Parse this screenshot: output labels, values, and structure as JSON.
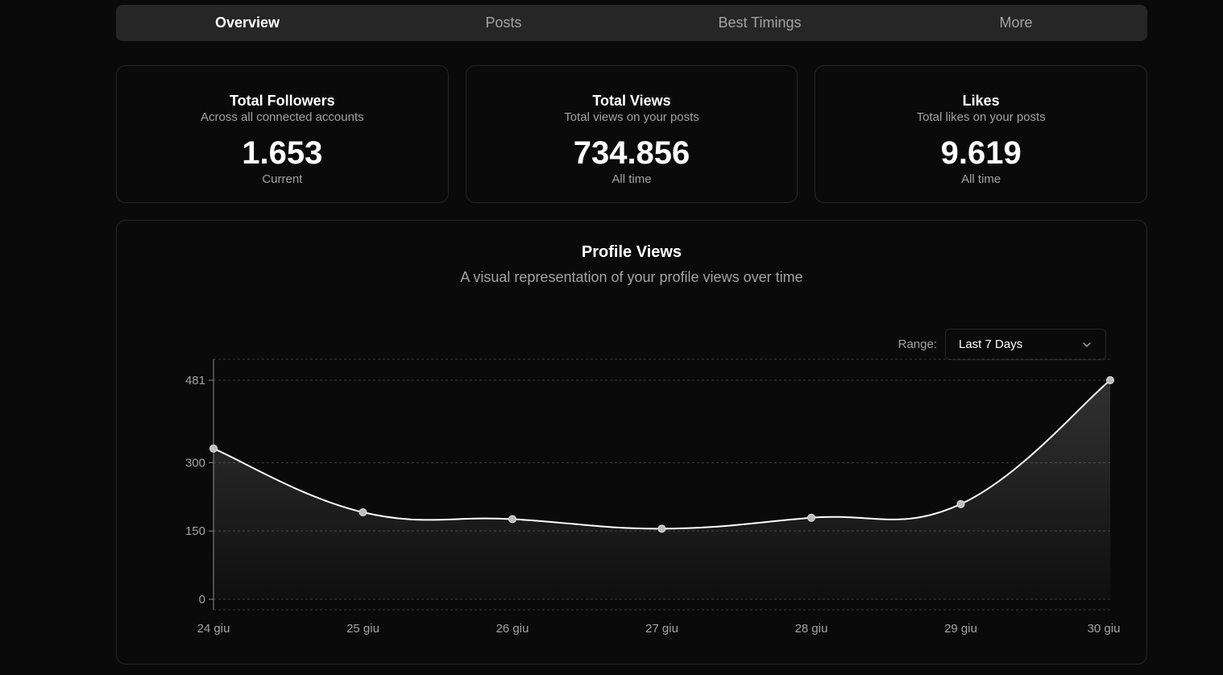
{
  "tabs": [
    {
      "label": "Overview",
      "active": true
    },
    {
      "label": "Posts",
      "active": false
    },
    {
      "label": "Best Timings",
      "active": false
    },
    {
      "label": "More",
      "active": false
    }
  ],
  "cards": [
    {
      "title": "Total Followers",
      "subtitle": "Across all connected accounts",
      "value": "1.653",
      "footer": "Current"
    },
    {
      "title": "Total Views",
      "subtitle": "Total views on your posts",
      "value": "734.856",
      "footer": "All time"
    },
    {
      "title": "Likes",
      "subtitle": "Total likes on your posts",
      "value": "9.619",
      "footer": "All time"
    }
  ],
  "profile_views": {
    "title": "Profile Views",
    "subtitle": "A visual representation of your profile views over time",
    "range_label": "Range:",
    "range_value": "Last 7 Days",
    "range_icon": "chevron-down-icon"
  },
  "colors": {
    "background": "#0a0a0a",
    "line": "#ffffff",
    "point": "#bdbdbd",
    "grid": "#3a3a3a"
  },
  "chart_data": {
    "type": "area",
    "title": "Profile Views",
    "x": [
      "24 giu",
      "25 giu",
      "26 giu",
      "27 giu",
      "28 giu",
      "29 giu",
      "30 giu"
    ],
    "values": [
      331,
      191,
      176,
      155,
      179,
      209,
      481
    ],
    "yticks": [
      0,
      150,
      300,
      481
    ],
    "ylim": [
      0,
      481
    ],
    "grid": true,
    "xlabel": "",
    "ylabel": ""
  }
}
